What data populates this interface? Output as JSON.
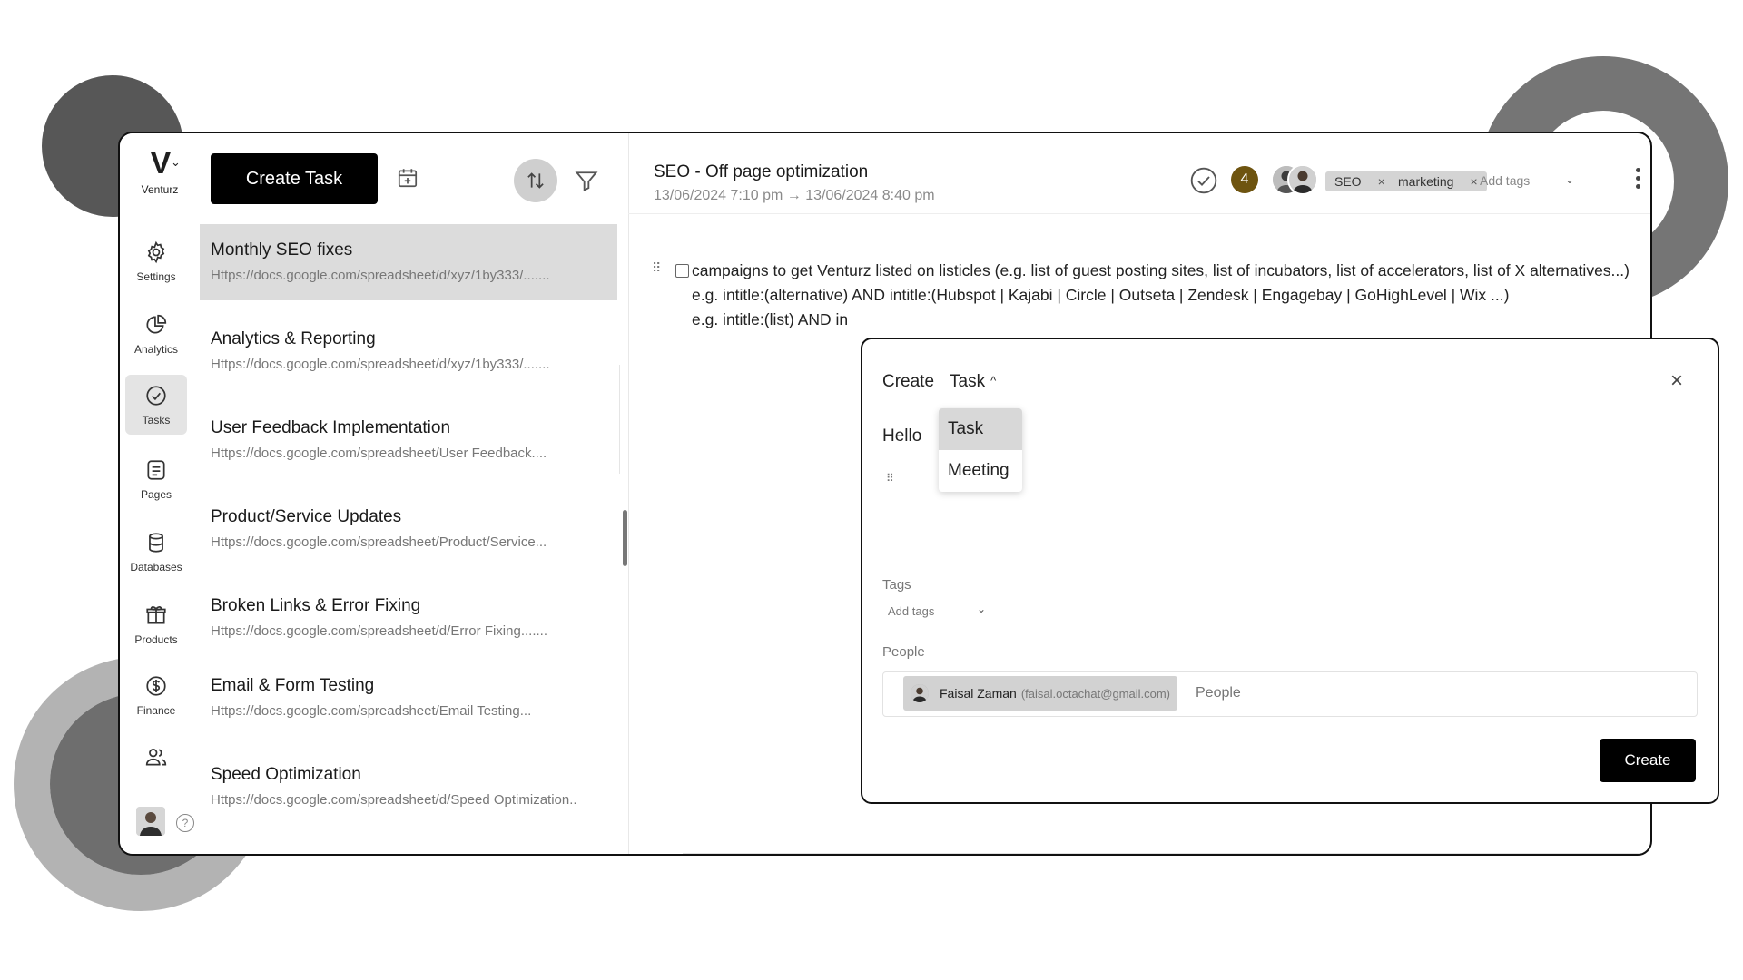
{
  "colors": {
    "accent": "#000000",
    "count_badge": "#6e5410",
    "selected_row": "#dcdcdc",
    "deco_dark": "#575757",
    "deco_mid": "#757575",
    "deco_light": "#b3b3b3"
  },
  "brand": {
    "name": "Venturz",
    "logo": "V"
  },
  "rail": {
    "items": [
      {
        "label": "Settings",
        "icon": "gear-icon"
      },
      {
        "label": "Analytics",
        "icon": "pie-chart-icon"
      },
      {
        "label": "Tasks",
        "icon": "check-circle-icon"
      },
      {
        "label": "Pages",
        "icon": "document-icon"
      },
      {
        "label": "Databases",
        "icon": "database-icon"
      },
      {
        "label": "Products",
        "icon": "gift-icon"
      },
      {
        "label": "Finance",
        "icon": "dollar-icon"
      },
      {
        "label": "",
        "icon": "users-icon"
      }
    ],
    "help": "?"
  },
  "list": {
    "create_label": "Create Task",
    "tasks": [
      {
        "title": "Monthly SEO fixes",
        "url": "Https://docs.google.com/spreadsheet/d/xyz/1by333/......."
      },
      {
        "title": "Analytics & Reporting",
        "url": "Https://docs.google.com/spreadsheet/d/xyz/1by333/......."
      },
      {
        "title": "User Feedback Implementation",
        "url": "Https://docs.google.com/spreadsheet/User Feedback...."
      },
      {
        "title": "Product/Service Updates",
        "url": "Https://docs.google.com/spreadsheet/Product/Service..."
      },
      {
        "title": "Broken Links & Error Fixing",
        "url": "Https://docs.google.com/spreadsheet/d/Error Fixing......."
      },
      {
        "title": "Email & Form Testing",
        "url": "Https://docs.google.com/spreadsheet/Email Testing..."
      },
      {
        "title": "Speed Optimization",
        "url": "Https://docs.google.com/spreadsheet/d/Speed Optimization.."
      }
    ]
  },
  "detail": {
    "title": "SEO - Off page optimization",
    "date": "13/06/2024 7:10 pm → 13/06/2024 8:40 pm",
    "count": "4",
    "tags": [
      "SEO",
      "marketing"
    ],
    "add_tags": "Add tags",
    "lines": [
      "campaigns to get Venturz listed on listicles (e.g. list of guest posting sites, list of incubators, list of accelerators, list of X alternatives...)",
      "e.g. intitle:(alternative) AND intitle:(Hubspot | Kajabi | Circle | Outseta | Zendesk | Engagebay | GoHighLevel | Wix ...)",
      "e.g. intitle:(list) AND in"
    ]
  },
  "modal": {
    "create_label": "Create",
    "type_value": "Task",
    "close": "×",
    "body": "Hello",
    "type_options": [
      "Task",
      "Meeting"
    ],
    "tags_label": "Tags",
    "add_tags": "Add tags",
    "people_label": "People",
    "person_name": "Faisal Zaman",
    "person_email": "(faisal.octachat@gmail.com)",
    "people_placeholder": "People",
    "submit": "Create"
  }
}
